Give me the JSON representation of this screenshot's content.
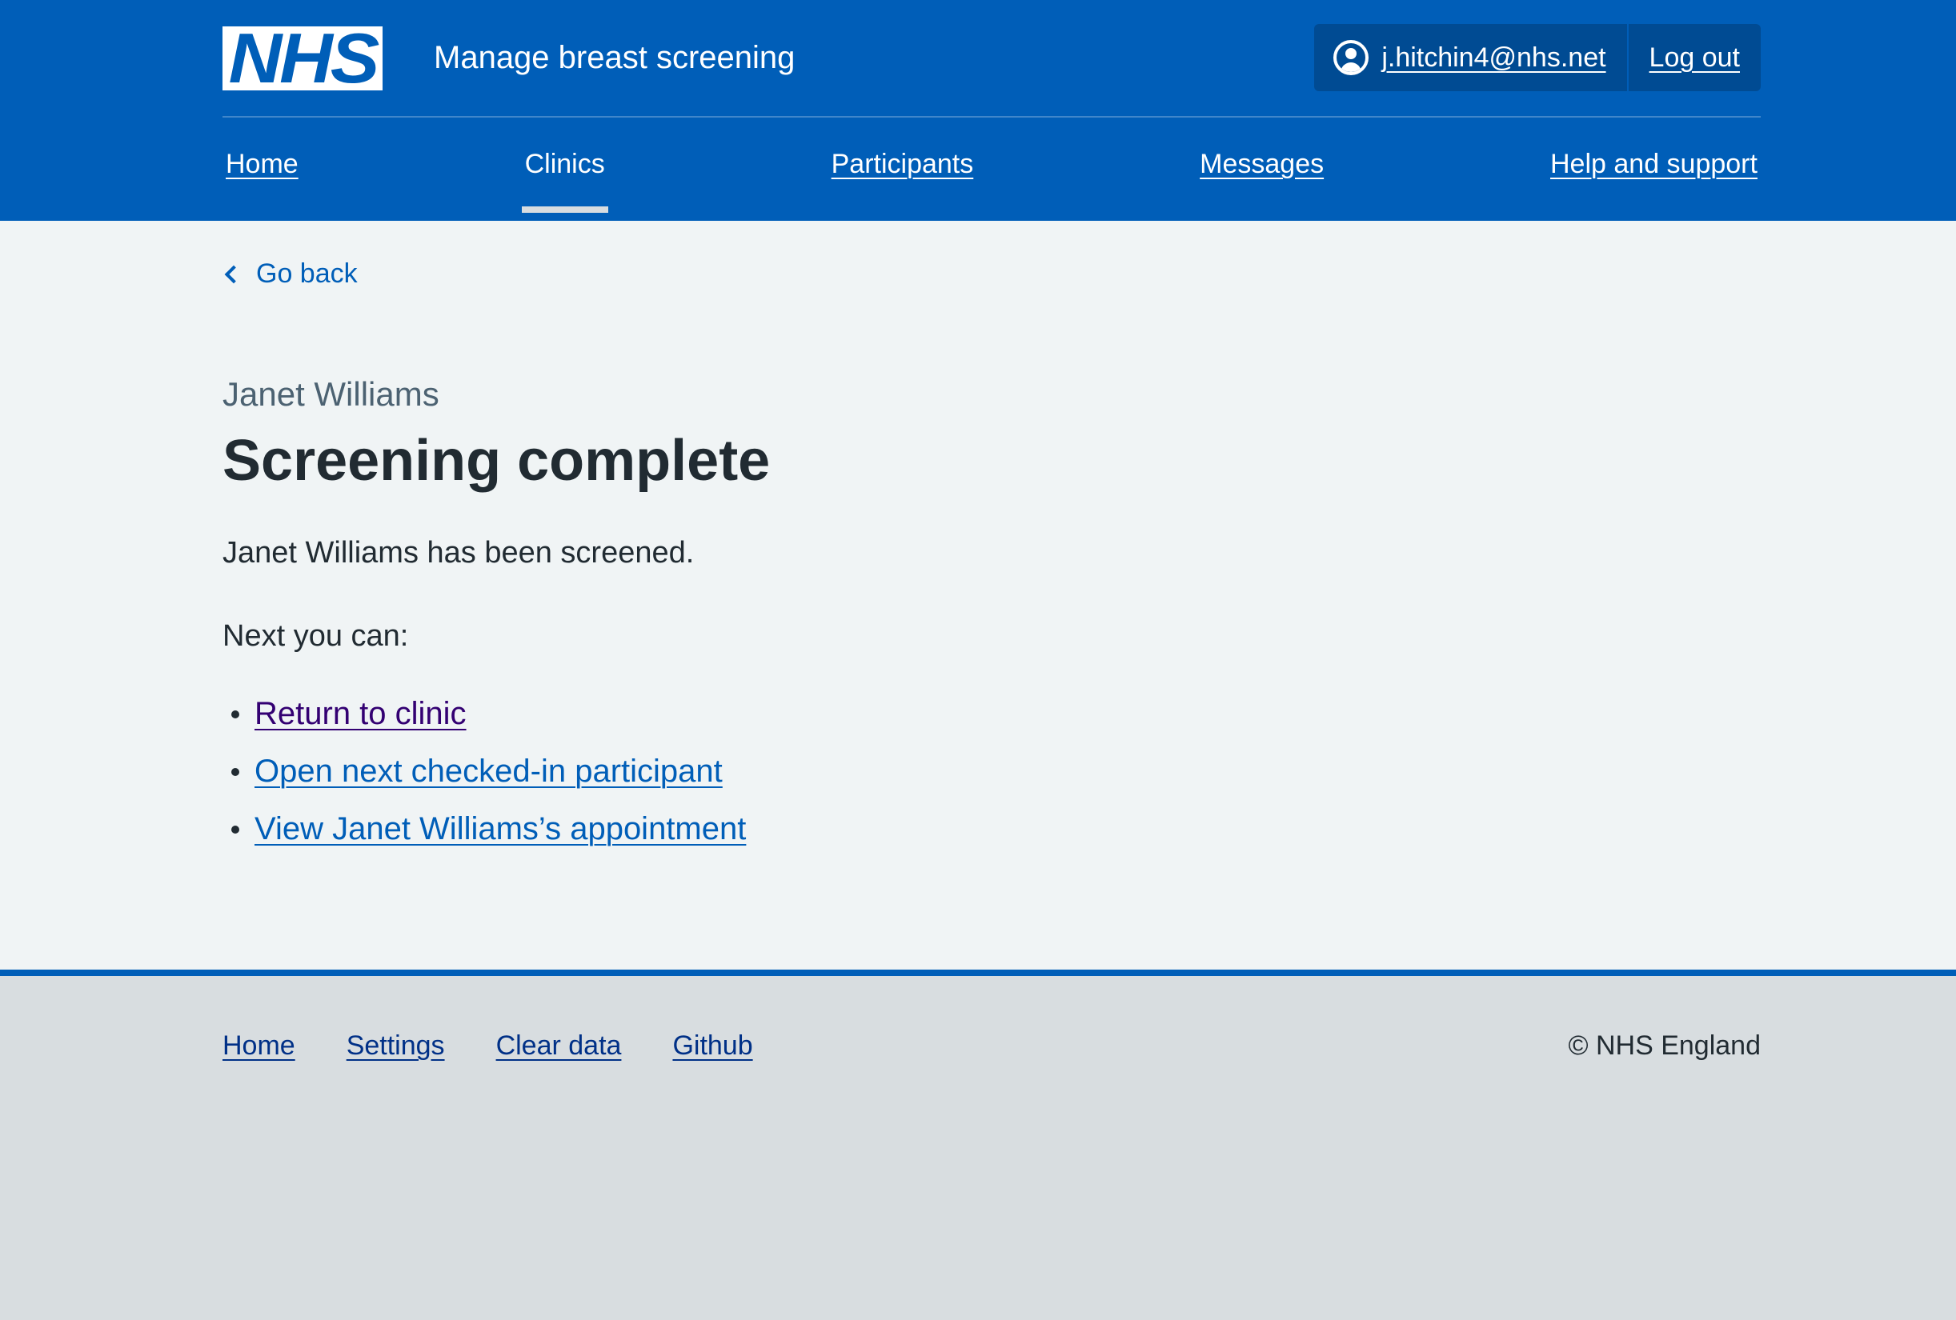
{
  "header": {
    "logo": "NHS",
    "service_name": "Manage breast screening",
    "account": {
      "email": "j.hitchin4@nhs.net",
      "logout_label": "Log out",
      "icon": "user-circle-icon"
    },
    "nav": [
      {
        "label": "Home",
        "current": false
      },
      {
        "label": "Clinics",
        "current": true
      },
      {
        "label": "Participants",
        "current": false
      },
      {
        "label": "Messages",
        "current": false
      },
      {
        "label": "Help and support",
        "current": false
      }
    ]
  },
  "main": {
    "back_link": "Go back",
    "caption": "Janet Williams",
    "title": "Screening complete",
    "body_text": "Janet Williams has been screened.",
    "next_text": "Next you can:",
    "links": [
      {
        "label": "Return to clinic",
        "visited": true
      },
      {
        "label": "Open next checked-in participant",
        "visited": false
      },
      {
        "label": "View Janet Williams’s appointment",
        "visited": false
      }
    ]
  },
  "footer": {
    "links": [
      "Home",
      "Settings",
      "Clear data",
      "Github"
    ],
    "copyright": "© NHS England"
  },
  "colors": {
    "nhs_blue": "#005eb8",
    "page_background": "#f0f4f5",
    "footer_background": "#d8dde0",
    "visited_link": "#330072",
    "footer_link": "#003087"
  }
}
